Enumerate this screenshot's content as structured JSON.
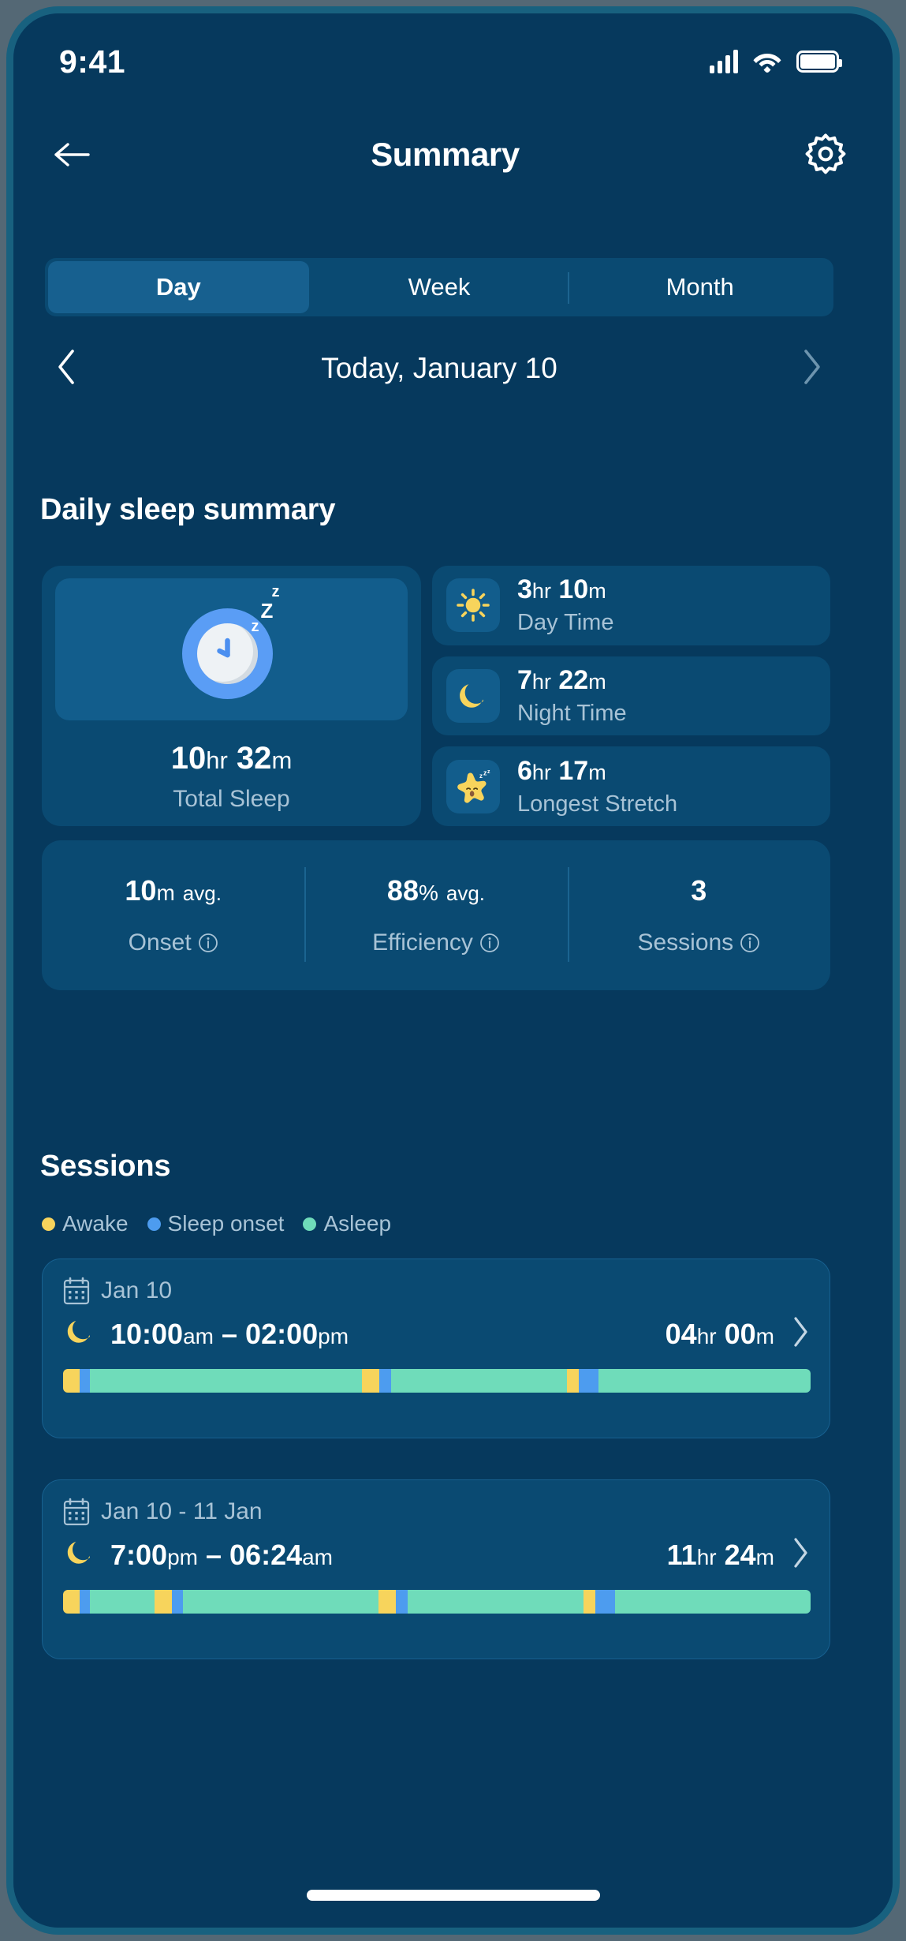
{
  "status_bar": {
    "time": "9:41",
    "signal_icon": "cellular-signal-icon",
    "wifi_icon": "wifi-icon",
    "battery_icon": "battery-icon"
  },
  "header": {
    "back_icon": "back-arrow-icon",
    "title": "Summary",
    "settings_icon": "gear-icon"
  },
  "tabs": {
    "items": [
      {
        "label": "Day",
        "active": true
      },
      {
        "label": "Week",
        "active": false
      },
      {
        "label": "Month",
        "active": false
      }
    ]
  },
  "date_nav": {
    "prev_icon": "chevron-left-icon",
    "label": "Today, January 10",
    "next_icon": "chevron-right-icon"
  },
  "daily_summary": {
    "title": "Daily sleep summary",
    "total": {
      "illustration": "sleeping-clock-icon",
      "zzz": {
        "small_1": "z",
        "big": "Z",
        "small_2": "z"
      },
      "hours": "10",
      "hours_unit": "hr",
      "minutes": "32",
      "minutes_unit": "m",
      "label": "Total Sleep"
    },
    "metrics": [
      {
        "icon": "sun-icon",
        "hours": "3",
        "hours_unit": "hr",
        "minutes": "10",
        "minutes_unit": "m",
        "label": "Day Time"
      },
      {
        "icon": "moon-icon",
        "hours": "7",
        "hours_unit": "hr",
        "minutes": "22",
        "minutes_unit": "m",
        "label": "Night Time"
      },
      {
        "icon": "sleeping-star-icon",
        "hours": "6",
        "hours_unit": "hr",
        "minutes": "17",
        "minutes_unit": "m",
        "label": "Longest Stretch"
      }
    ]
  },
  "stats": [
    {
      "value": "10",
      "unit": "m",
      "suffix": "avg.",
      "label": "Onset",
      "info_icon": "info-icon"
    },
    {
      "value": "88",
      "unit": "%",
      "suffix": "avg.",
      "label": "Efficiency",
      "info_icon": "info-icon"
    },
    {
      "value": "3",
      "unit": "",
      "suffix": "",
      "label": "Sessions",
      "info_icon": "info-icon"
    }
  ],
  "sessions_section": {
    "title": "Sessions",
    "legend": [
      {
        "label": "Awake",
        "color": "#F7D45C"
      },
      {
        "label": "Sleep onset",
        "color": "#4D9CEF"
      },
      {
        "label": "Asleep",
        "color": "#6FDCBA"
      }
    ],
    "items": [
      {
        "calendar_icon": "calendar-icon",
        "date": "Jan 10",
        "moon_icon": "moon-icon",
        "start_time": "10:00",
        "start_meridiem": "am",
        "dash": "–",
        "end_time": "02:00",
        "end_meridiem": "pm",
        "duration_hours": "04",
        "duration_hours_unit": "hr",
        "duration_minutes": "00",
        "duration_minutes_unit": "m",
        "chevron_icon": "chevron-right-icon",
        "timeline": [
          {
            "state": "Awake",
            "color": "#F7D45C",
            "pct": 2.2
          },
          {
            "state": "Sleep onset",
            "color": "#4D9CEF",
            "pct": 1.4
          },
          {
            "state": "Asleep",
            "color": "#6FDCBA",
            "pct": 36.4
          },
          {
            "state": "Awake",
            "color": "#F7D45C",
            "pct": 2.3
          },
          {
            "state": "Sleep onset",
            "color": "#4D9CEF",
            "pct": 1.6
          },
          {
            "state": "Asleep",
            "color": "#6FDCBA",
            "pct": 23.5
          },
          {
            "state": "Awake",
            "color": "#F7D45C",
            "pct": 1.6
          },
          {
            "state": "Sleep onset",
            "color": "#4D9CEF",
            "pct": 2.6
          },
          {
            "state": "Asleep",
            "color": "#6FDCBA",
            "pct": 28.4
          }
        ]
      },
      {
        "calendar_icon": "calendar-icon",
        "date": "Jan 10 - 11 Jan",
        "moon_icon": "moon-icon",
        "start_time": "7:00",
        "start_meridiem": "pm",
        "dash": "–",
        "end_time": "06:24",
        "end_meridiem": "am",
        "duration_hours": "11",
        "duration_hours_unit": "hr",
        "duration_minutes": "24",
        "duration_minutes_unit": "m",
        "chevron_icon": "chevron-right-icon",
        "timeline": [
          {
            "state": "Awake",
            "color": "#F7D45C",
            "pct": 2.2
          },
          {
            "state": "Sleep onset",
            "color": "#4D9CEF",
            "pct": 1.4
          },
          {
            "state": "Asleep",
            "color": "#6FDCBA",
            "pct": 8.6
          },
          {
            "state": "Awake",
            "color": "#F7D45C",
            "pct": 2.4
          },
          {
            "state": "Sleep onset",
            "color": "#4D9CEF",
            "pct": 1.4
          },
          {
            "state": "Asleep",
            "color": "#6FDCBA",
            "pct": 26.2
          },
          {
            "state": "Awake",
            "color": "#F7D45C",
            "pct": 2.3
          },
          {
            "state": "Sleep onset",
            "color": "#4D9CEF",
            "pct": 1.6
          },
          {
            "state": "Asleep",
            "color": "#6FDCBA",
            "pct": 23.5
          },
          {
            "state": "Awake",
            "color": "#F7D45C",
            "pct": 1.6
          },
          {
            "state": "Sleep onset",
            "color": "#4D9CEF",
            "pct": 2.6
          },
          {
            "state": "Asleep",
            "color": "#6FDCBA",
            "pct": 26.2
          }
        ]
      }
    ]
  },
  "theme": {
    "background": "#06395d",
    "card": "#0a4a72",
    "card_light": "#125d8c",
    "accent_active": "#17608f",
    "text_primary": "#ffffff",
    "text_secondary": "#a8c3d6",
    "awake": "#F7D45C",
    "sleep_onset": "#4D9CEF",
    "asleep": "#6FDCBA",
    "frame": "#18617f"
  }
}
